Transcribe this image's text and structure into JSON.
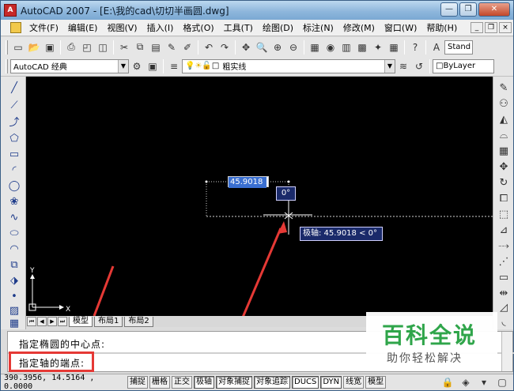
{
  "window": {
    "title": "AutoCAD 2007 - [E:\\我的cad\\切切半画圆.dwg]",
    "icon_label": "A"
  },
  "menu": {
    "items": [
      "文件(F)",
      "编辑(E)",
      "视图(V)",
      "插入(I)",
      "格式(O)",
      "工具(T)",
      "绘图(D)",
      "标注(N)",
      "修改(M)",
      "窗口(W)",
      "帮助(H)"
    ]
  },
  "toolbar": {
    "workspace_value": "AutoCAD 经典",
    "layer_value": "粗实线",
    "bylayer_value": "ByLayer",
    "style_value": "Stand"
  },
  "canvas": {
    "dyn_input_value": "45.9018",
    "angle_value": "0°",
    "polar_tooltip": "极轴: 45.9018 < 0°",
    "ucs_x": "X",
    "ucs_y": "Y"
  },
  "tabs": {
    "items": [
      "模型",
      "布局1",
      "布局2"
    ]
  },
  "command": {
    "line1": "指定椭圆的中心点:",
    "line2": "指定轴的端点:"
  },
  "status": {
    "coords": "390.3956, 14.5164 , 0.0000",
    "buttons": [
      "捕捉",
      "栅格",
      "正交",
      "极轴",
      "对象捕捉",
      "对象追踪",
      "DUCS",
      "DYN",
      "线宽",
      "模型"
    ],
    "active": [
      "极轴",
      "对象捕捉",
      "对象追踪",
      "DUCS",
      "DYN"
    ]
  },
  "watermark": {
    "title": "百科全说",
    "subtitle": "助你轻松解决"
  },
  "colors": {
    "canvas": "#000000",
    "annotation": "#e53935",
    "watermark_green": "#2fa54a",
    "selection_blue": "#3a6fd1"
  }
}
